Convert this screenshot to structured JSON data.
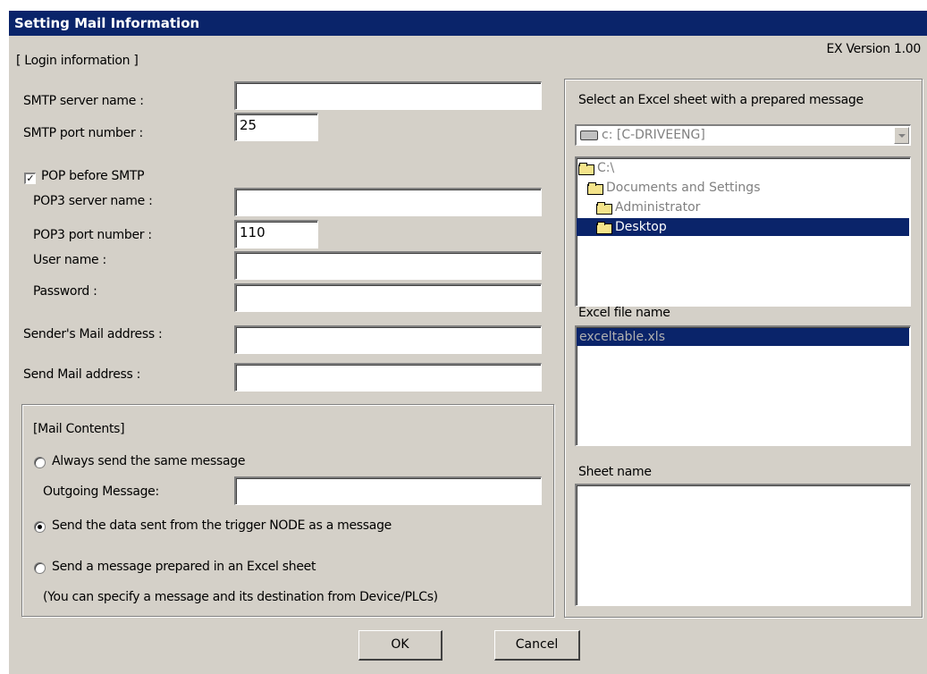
{
  "window": {
    "title": "Setting Mail Information",
    "version": "EX Version 1.00"
  },
  "login": {
    "section_label": "[ Login information ]",
    "smtp_server_label": "SMTP server name :",
    "smtp_server_value": "",
    "smtp_port_label": "SMTP port number :",
    "smtp_port_value": "25",
    "pop_before_smtp_label": "POP before SMTP",
    "pop_before_smtp_checked": true,
    "pop3_server_label": "POP3 server name :",
    "pop3_server_value": "",
    "pop3_port_label": "POP3 port number :",
    "pop3_port_value": "110",
    "user_label": "User name :",
    "user_value": "",
    "password_label": "Password :",
    "password_value": "",
    "sender_label": "Sender's Mail address :",
    "sender_value": "",
    "send_label": "Send Mail address :",
    "send_value": ""
  },
  "mail_contents": {
    "section_label": "[Mail Contents]",
    "option_same_label": "Always send the same message",
    "outgoing_label": "Outgoing Message:",
    "outgoing_value": "",
    "option_trigger_label": "Send the data sent from the trigger NODE  as a message",
    "option_excel_label": "Send a message prepared in an Excel sheet",
    "excel_note": "(You can specify a message and its destination from Device/PLCs)",
    "selected": "trigger"
  },
  "excel": {
    "heading": "Select an Excel sheet with a prepared message",
    "drive": "c: [C-DRIVEENG]",
    "folders": [
      "C:\\",
      "Documents and Settings",
      "Administrator",
      "Desktop"
    ],
    "selected_folder": "Desktop",
    "file_label": "Excel file name",
    "files": [
      "exceltable.xls"
    ],
    "sheet_label": "Sheet name"
  },
  "buttons": {
    "ok": "OK",
    "cancel": "Cancel"
  },
  "colors": {
    "title_bar": "#0a246a",
    "dialog_bg": "#d4d0c8",
    "selection": "#0a246a"
  }
}
